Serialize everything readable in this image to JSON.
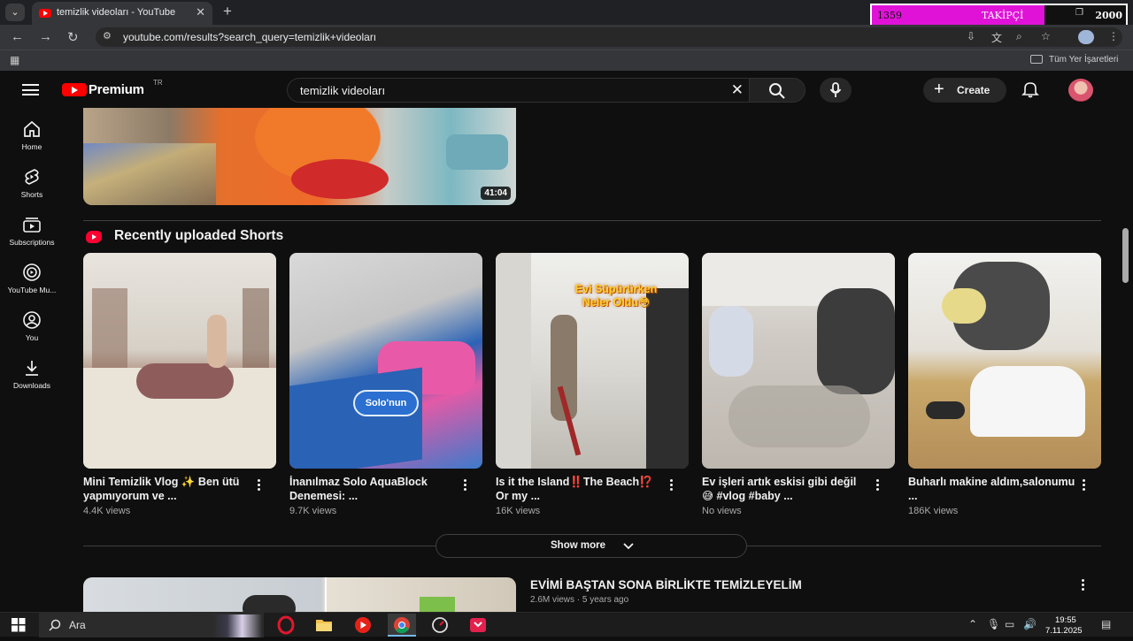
{
  "browser": {
    "tab_title": "temizlik videoları - YouTube",
    "new_tab": "+",
    "tab_close": "✕",
    "url": "youtube.com/results?search_query=temizlik+videoları",
    "bookmarks_label": "Tüm Yer İşaretleri"
  },
  "follower_widget": {
    "current": "1359",
    "label": "TAKİPÇİ",
    "goal": "2000",
    "progress_fraction": 0.6795,
    "fill_color": "#e012d8"
  },
  "header": {
    "brand": "Premium",
    "country": "TR",
    "search_query": "temizlik videoları",
    "create_label": "Create"
  },
  "sidebar": {
    "items": [
      {
        "label": "Home",
        "icon": "home-icon"
      },
      {
        "label": "Shorts",
        "icon": "shorts-icon"
      },
      {
        "label": "Subscriptions",
        "icon": "subscriptions-icon"
      },
      {
        "label": "YouTube Mu...",
        "icon": "youtube-music-icon"
      },
      {
        "label": "You",
        "icon": "you-icon"
      },
      {
        "label": "Downloads",
        "icon": "download-icon"
      }
    ]
  },
  "top_video": {
    "duration": "41:04"
  },
  "shorts_section": {
    "title": "Recently uploaded Shorts",
    "items": [
      {
        "title": "Mini Temizlik Vlog ✨ Ben ütü yapmıyorum ve ...",
        "views": "4.4K views"
      },
      {
        "title": "İnanılmaz Solo AquaBlock Denemesi: ...",
        "views": "9.7K views",
        "overlay": "Solo'nun"
      },
      {
        "title": "Is it the Island‼️The Beach⁉️Or my ...",
        "views": "16K views",
        "overlay": "Evi Süpürürken Neler Oldu😳"
      },
      {
        "title": "Ev işleri artık eskisi gibi değil 😅 #vlog #baby ...",
        "views": "No views"
      },
      {
        "title": "Buharlı makine aldım,salonumu ...",
        "views": "186K views"
      }
    ],
    "show_more": "Show more"
  },
  "next_video": {
    "title": "EVİMİ BAŞTAN SONA BİRLİKTE TEMİZLEYELİM",
    "views": "2.6M views",
    "age": "5 years ago"
  },
  "taskbar": {
    "search_placeholder": "Ara",
    "time": "19:55",
    "date": "7.11.2025"
  }
}
